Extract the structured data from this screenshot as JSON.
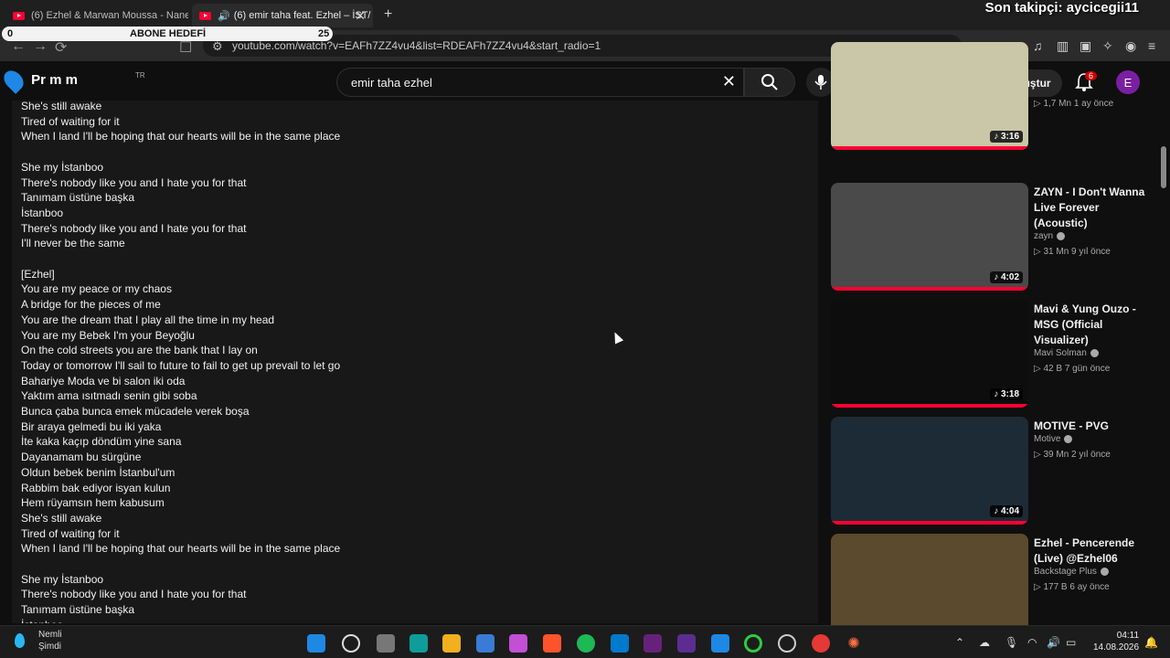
{
  "browser": {
    "tabs": [
      {
        "label": "(6) Ezhel & Marwan Moussa - Nane"
      },
      {
        "label": "(6) emir taha feat. Ezhel – İST/"
      }
    ],
    "url": "youtube.com/watch?v=EAFh7ZZ4vu4&list=RDEAFh7ZZ4vu4&start_radio=1"
  },
  "stream_overlay": {
    "follower_text": "Son takipçi: aycicegii11",
    "goal_label": "ABONE HEDEFİ",
    "goal_current": "0",
    "goal_target": "25",
    "goal_progress": 0
  },
  "youtube_header": {
    "logo_text": "Pr m m",
    "region": "TR",
    "search_value": "emir taha ezhel",
    "create_label": "Oluştur",
    "notification_count": "6",
    "avatar_letter": "E"
  },
  "lyrics": [
    "She's still awake",
    "Tired of waiting for it",
    "When I land I'll be hoping that our hearts will be in the same place",
    "",
    "She my İstanboo",
    "There's nobody like you and I hate you for that",
    "Tanımam üstüne başka",
    "İstanboo",
    "There's nobody like you and I hate you for that",
    "I'll never be the same",
    "",
    "[Ezhel]",
    "You are my peace or my chaos",
    "A bridge for the pieces of me",
    "You are the dream that I play all the time in my head",
    "You are my Bebek I'm your Beyoğlu",
    "On the cold streets you are the bank that I lay on",
    "Today or tomorrow I'll sail to future to fail to get up prevail to let go",
    "Bahariye Moda ve bi salon iki oda",
    "Yaktım ama ısıtmadı senin gibi soba",
    "Bunca çaba bunca emek mücadele verek boşa",
    "Bir araya gelmedi bu iki yaka",
    "İte kaka kaçıp döndüm yine sana",
    "Dayanamam bu sürgüne",
    "Oldun bebek benim İstanbul'um",
    "Rabbim bak ediyor isyan kulun",
    "Hem rüyamsın hem kabusum",
    "She's still awake",
    "Tired of waiting for it",
    "When I land I'll be hoping that our hearts will be in the same place",
    "",
    "She my İstanboo",
    "There's nobody like you and I hate you for that",
    "Tanımam üstüne başka",
    "İstanboo"
  ],
  "recommendations": [
    {
      "title": "",
      "channel": "",
      "meta": "1,7 Mn   1 ay önce",
      "duration": "3:16",
      "thumb_color": "#c9c7a8"
    },
    {
      "title": "ZAYN - I Don't Wanna Live Forever (Acoustic)",
      "channel": "zayn",
      "meta": "31 Mn   9 yıl önce",
      "duration": "4:02",
      "thumb_color": "#4a4a4a"
    },
    {
      "title": "Mavi & Yung Ouzo - MSG (Official Visualizer)",
      "channel": "Mavi Solman",
      "meta": "42 B   7 gün önce",
      "duration": "3:18",
      "thumb_color": "#0d0d0d"
    },
    {
      "title": "MOTIVE - PVG",
      "channel": "Motive",
      "meta": "39 Mn   2 yıl önce",
      "duration": "4:04",
      "thumb_color": "#1d2b36"
    },
    {
      "title": "Ezhel - Pencerende (Live) @Ezhel06",
      "channel": "Backstage Plus",
      "meta": "177 B   6 ay önce",
      "duration": "",
      "thumb_color": "#5b4a2e"
    }
  ],
  "taskbar": {
    "weather_line1": "Nemli",
    "weather_line2": "Şimdi",
    "time": "04:11",
    "date": "14.08.2026"
  },
  "colors": {
    "accent_red": "#ff0033",
    "background": "#0f0f0f",
    "panel": "#181818"
  }
}
